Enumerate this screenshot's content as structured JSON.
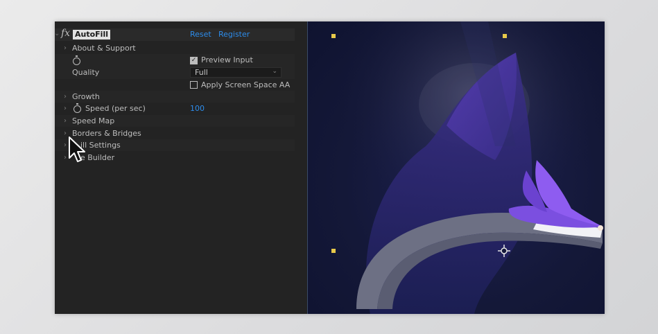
{
  "effect": {
    "name": "AutoFill",
    "fx_icon": "fx",
    "reset_label": "Reset",
    "register_label": "Register"
  },
  "properties": {
    "about": "About & Support",
    "quality_label": "Quality",
    "preview_input": "Preview Input",
    "quality_value": "Full",
    "apply_aa": "Apply Screen Space AA",
    "growth": "Growth",
    "speed_label": "Speed (per sec)",
    "speed_value": "100",
    "speed_map": "Speed Map",
    "borders": "Borders & Bridges",
    "fill_settings": "ill Settings",
    "shape_builder": "e Builder"
  },
  "checkboxes": {
    "preview_input_checked": true,
    "apply_aa_checked": false
  },
  "colors": {
    "accent_blue": "#2d8ceb",
    "handle_yellow": "#e8c94a",
    "fox_purple": "#7b4fe0"
  },
  "icons": [
    "fx-icon",
    "stopwatch-icon",
    "chevron-down-icon",
    "twirl-arrow-icon",
    "mouse-pointer-icon",
    "anchor-point-icon"
  ]
}
